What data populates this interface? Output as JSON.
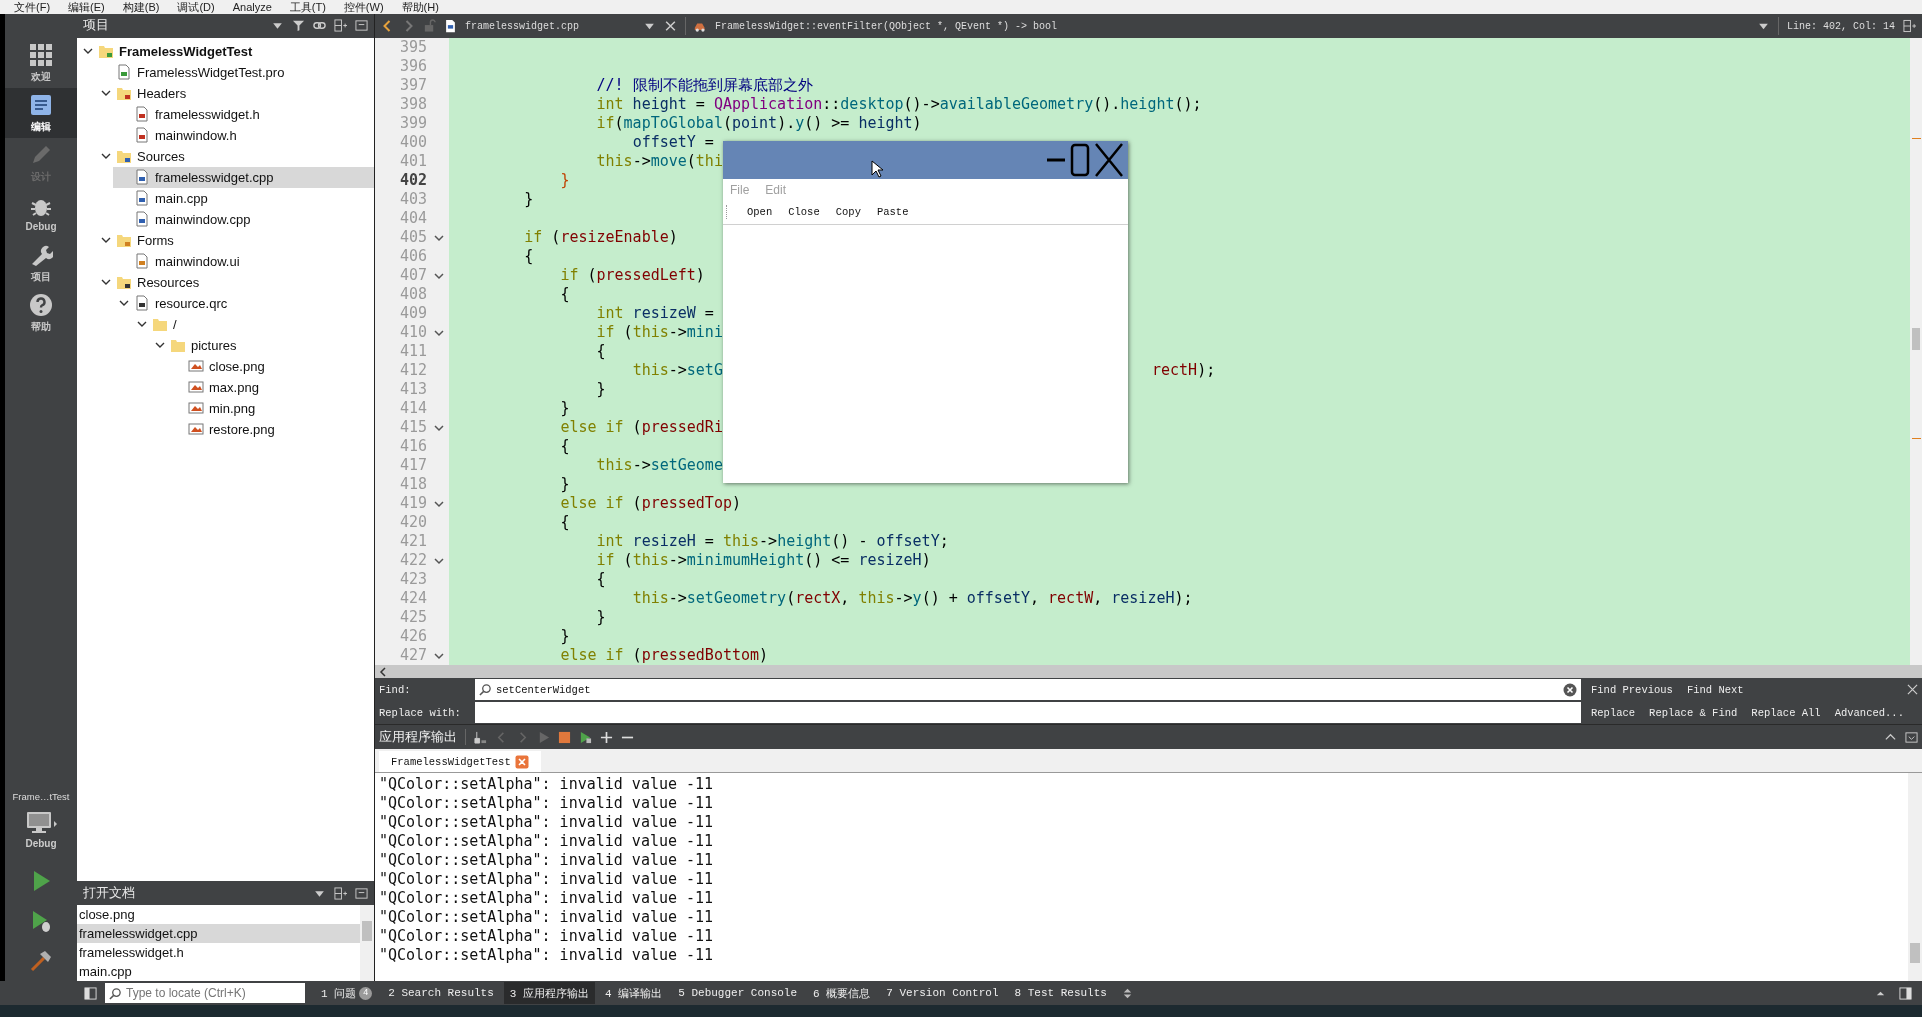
{
  "menu": [
    "文件(F)",
    "编辑(E)",
    "构建(B)",
    "调试(D)",
    "Analyze",
    "工具(T)",
    "控件(W)",
    "帮助(H)"
  ],
  "mode_bar": {
    "items": [
      {
        "label": "欢迎",
        "kind": "welcome",
        "selected": false,
        "disabled": false
      },
      {
        "label": "编辑",
        "kind": "edit",
        "selected": true,
        "disabled": false
      },
      {
        "label": "设计",
        "kind": "design",
        "selected": false,
        "disabled": true
      },
      {
        "label": "Debug",
        "kind": "debug",
        "selected": false,
        "disabled": false
      },
      {
        "label": "项目",
        "kind": "projects",
        "selected": false,
        "disabled": false
      },
      {
        "label": "帮助",
        "kind": "help",
        "selected": false,
        "disabled": false
      }
    ],
    "kit": "Frame…tTest",
    "build_config": "Debug"
  },
  "project_panel": {
    "title": "项目",
    "tree": [
      {
        "label": "FramelessWidgetTest",
        "kind": "project",
        "expanded": true,
        "selected": false,
        "children": [
          {
            "label": "FramelessWidgetTest.pro",
            "kind": "pro",
            "selected": false
          },
          {
            "label": "Headers",
            "kind": "headers",
            "expanded": true,
            "selected": false,
            "children": [
              {
                "label": "framelesswidget.h",
                "kind": "h",
                "selected": false
              },
              {
                "label": "mainwindow.h",
                "kind": "h",
                "selected": false
              }
            ]
          },
          {
            "label": "Sources",
            "kind": "sources",
            "expanded": true,
            "selected": false,
            "children": [
              {
                "label": "framelesswidget.cpp",
                "kind": "cpp",
                "selected": true
              },
              {
                "label": "main.cpp",
                "kind": "cpp",
                "selected": false
              },
              {
                "label": "mainwindow.cpp",
                "kind": "cpp",
                "selected": false
              }
            ]
          },
          {
            "label": "Forms",
            "kind": "forms",
            "expanded": true,
            "selected": false,
            "children": [
              {
                "label": "mainwindow.ui",
                "kind": "ui",
                "selected": false
              }
            ]
          },
          {
            "label": "Resources",
            "kind": "resources",
            "expanded": true,
            "selected": false,
            "children": [
              {
                "label": "resource.qrc",
                "kind": "qrc",
                "expanded": true,
                "selected": false,
                "children": [
                  {
                    "label": "/",
                    "kind": "folder",
                    "expanded": true,
                    "selected": false,
                    "children": [
                      {
                        "label": "pictures",
                        "kind": "folder",
                        "expanded": true,
                        "selected": false,
                        "children": [
                          {
                            "label": "close.png",
                            "kind": "png",
                            "selected": false
                          },
                          {
                            "label": "max.png",
                            "kind": "png",
                            "selected": false
                          },
                          {
                            "label": "min.png",
                            "kind": "png",
                            "selected": false
                          },
                          {
                            "label": "restore.png",
                            "kind": "png",
                            "selected": false
                          }
                        ]
                      }
                    ]
                  }
                ]
              }
            ]
          }
        ]
      }
    ]
  },
  "open_documents": {
    "title": "打开文档",
    "items": [
      {
        "label": "close.png",
        "selected": false
      },
      {
        "label": "framelesswidget.cpp",
        "selected": true
      },
      {
        "label": "framelesswidget.h",
        "selected": false
      },
      {
        "label": "main.cpp",
        "selected": false
      }
    ]
  },
  "editor": {
    "file": "framelesswidget.cpp",
    "symbol": "FramelessWidget::eventFilter(QObject *, QEvent *) -> bool",
    "position": "Line: 402, Col: 14",
    "lines": [
      {
        "number": "395",
        "current": false
      },
      {
        "number": "396",
        "current": false
      },
      {
        "number": "397",
        "current": false,
        "code": [
          {
            "kind": "comment",
            "text": "                //! 限制不能拖到屏幕底部之外"
          }
        ]
      },
      {
        "number": "398",
        "current": false,
        "code": [
          {
            "kind": "keyword",
            "text": "                int"
          },
          {
            "kind": "local",
            "text": " height"
          },
          {
            "kind": "plain",
            "text": " = "
          },
          {
            "kind": "class",
            "text": "QApplication"
          },
          {
            "kind": "plain",
            "text": "::"
          },
          {
            "kind": "function",
            "text": "desktop"
          },
          {
            "kind": "plain",
            "text": "()->"
          },
          {
            "kind": "function",
            "text": "availableGeometry"
          },
          {
            "kind": "plain",
            "text": "()."
          },
          {
            "kind": "function",
            "text": "height"
          },
          {
            "kind": "plain",
            "text": "();"
          }
        ]
      },
      {
        "number": "399",
        "current": false,
        "code": [
          {
            "kind": "keyword",
            "text": "                if"
          },
          {
            "kind": "plain",
            "text": "("
          },
          {
            "kind": "function",
            "text": "mapToGlobal"
          },
          {
            "kind": "plain",
            "text": "("
          },
          {
            "kind": "local",
            "text": "point"
          },
          {
            "kind": "plain",
            "text": ")."
          },
          {
            "kind": "function",
            "text": "y"
          },
          {
            "kind": "plain",
            "text": "() >= "
          },
          {
            "kind": "local",
            "text": "height"
          },
          {
            "kind": "plain",
            "text": ")"
          }
        ]
      },
      {
        "number": "400",
        "current": false,
        "code": [
          {
            "kind": "local",
            "text": "                    offsetY"
          },
          {
            "kind": "plain",
            "text": " ="
          }
        ]
      },
      {
        "number": "401",
        "current": false,
        "code": [
          {
            "kind": "keyword",
            "text": "                this"
          },
          {
            "kind": "plain",
            "text": "->"
          },
          {
            "kind": "function",
            "text": "move"
          },
          {
            "kind": "plain",
            "text": "("
          },
          {
            "kind": "keyword",
            "text": "thi"
          }
        ]
      },
      {
        "number": "402",
        "current": true,
        "code": [
          {
            "kind": "brace",
            "text": "            }"
          }
        ]
      },
      {
        "number": "403",
        "current": false,
        "code": [
          {
            "kind": "plain",
            "text": "        }"
          }
        ]
      },
      {
        "number": "404",
        "current": false
      },
      {
        "number": "405",
        "current": false,
        "fold": true,
        "code": [
          {
            "kind": "keyword",
            "text": "        if"
          },
          {
            "kind": "plain",
            "text": " ("
          },
          {
            "kind": "member",
            "text": "resizeEnable"
          },
          {
            "kind": "plain",
            "text": ")"
          }
        ]
      },
      {
        "number": "406",
        "current": false,
        "code": [
          {
            "kind": "plain",
            "text": "        {"
          }
        ]
      },
      {
        "number": "407",
        "current": false,
        "fold": true,
        "code": [
          {
            "kind": "keyword",
            "text": "            if"
          },
          {
            "kind": "plain",
            "text": " ("
          },
          {
            "kind": "member",
            "text": "pressedLeft"
          },
          {
            "kind": "plain",
            "text": ")"
          }
        ]
      },
      {
        "number": "408",
        "current": false,
        "code": [
          {
            "kind": "plain",
            "text": "            {"
          }
        ]
      },
      {
        "number": "409",
        "current": false,
        "code": [
          {
            "kind": "keyword",
            "text": "                int"
          },
          {
            "kind": "local",
            "text": " resizeW"
          },
          {
            "kind": "plain",
            "text": " ="
          }
        ]
      },
      {
        "number": "410",
        "current": false,
        "fold": true,
        "code": [
          {
            "kind": "keyword",
            "text": "                if"
          },
          {
            "kind": "plain",
            "text": " ("
          },
          {
            "kind": "keyword",
            "text": "this"
          },
          {
            "kind": "plain",
            "text": "->"
          },
          {
            "kind": "function",
            "text": "mini"
          }
        ]
      },
      {
        "number": "411",
        "current": false,
        "code": [
          {
            "kind": "plain",
            "text": "                {"
          }
        ]
      },
      {
        "number": "412",
        "current": false,
        "code": [
          {
            "kind": "keyword",
            "text": "                    this"
          },
          {
            "kind": "plain",
            "text": "->"
          },
          {
            "kind": "function",
            "text": "setG"
          }
        ],
        "tail": [
          {
            "kind": "member",
            "text": "rectH"
          },
          {
            "kind": "plain",
            "text": ");"
          }
        ]
      },
      {
        "number": "413",
        "current": false,
        "code": [
          {
            "kind": "plain",
            "text": "                }"
          }
        ]
      },
      {
        "number": "414",
        "current": false,
        "code": [
          {
            "kind": "plain",
            "text": "            }"
          }
        ]
      },
      {
        "number": "415",
        "current": false,
        "fold": true,
        "code": [
          {
            "kind": "keyword",
            "text": "            else if"
          },
          {
            "kind": "plain",
            "text": " ("
          },
          {
            "kind": "member",
            "text": "pressedRi"
          }
        ]
      },
      {
        "number": "416",
        "current": false,
        "code": [
          {
            "kind": "plain",
            "text": "            {"
          }
        ]
      },
      {
        "number": "417",
        "current": false,
        "code": [
          {
            "kind": "keyword",
            "text": "                this"
          },
          {
            "kind": "plain",
            "text": "->"
          },
          {
            "kind": "function",
            "text": "setGeome"
          }
        ]
      },
      {
        "number": "418",
        "current": false,
        "code": [
          {
            "kind": "plain",
            "text": "            }"
          }
        ]
      },
      {
        "number": "419",
        "current": false,
        "fold": true,
        "code": [
          {
            "kind": "keyword",
            "text": "            else if"
          },
          {
            "kind": "plain",
            "text": " ("
          },
          {
            "kind": "member",
            "text": "pressedTop"
          },
          {
            "kind": "plain",
            "text": ")"
          }
        ]
      },
      {
        "number": "420",
        "current": false,
        "code": [
          {
            "kind": "plain",
            "text": "            {"
          }
        ]
      },
      {
        "number": "421",
        "current": false,
        "code": [
          {
            "kind": "keyword",
            "text": "                int"
          },
          {
            "kind": "local",
            "text": " resizeH"
          },
          {
            "kind": "plain",
            "text": " = "
          },
          {
            "kind": "keyword",
            "text": "this"
          },
          {
            "kind": "plain",
            "text": "->"
          },
          {
            "kind": "function",
            "text": "height"
          },
          {
            "kind": "plain",
            "text": "() - "
          },
          {
            "kind": "local",
            "text": "offsetY"
          },
          {
            "kind": "plain",
            "text": ";"
          }
        ]
      },
      {
        "number": "422",
        "current": false,
        "fold": true,
        "code": [
          {
            "kind": "keyword",
            "text": "                if"
          },
          {
            "kind": "plain",
            "text": " ("
          },
          {
            "kind": "keyword",
            "text": "this"
          },
          {
            "kind": "plain",
            "text": "->"
          },
          {
            "kind": "function",
            "text": "minimumHeight"
          },
          {
            "kind": "plain",
            "text": "() <= "
          },
          {
            "kind": "local",
            "text": "resizeH"
          },
          {
            "kind": "plain",
            "text": ")"
          }
        ]
      },
      {
        "number": "423",
        "current": false,
        "code": [
          {
            "kind": "plain",
            "text": "                {"
          }
        ]
      },
      {
        "number": "424",
        "current": false,
        "code": [
          {
            "kind": "keyword",
            "text": "                    this"
          },
          {
            "kind": "plain",
            "text": "->"
          },
          {
            "kind": "function",
            "text": "setGeometry"
          },
          {
            "kind": "plain",
            "text": "("
          },
          {
            "kind": "member",
            "text": "rectX"
          },
          {
            "kind": "plain",
            "text": ", "
          },
          {
            "kind": "keyword",
            "text": "this"
          },
          {
            "kind": "plain",
            "text": "->"
          },
          {
            "kind": "function",
            "text": "y"
          },
          {
            "kind": "plain",
            "text": "() + "
          },
          {
            "kind": "local",
            "text": "offsetY"
          },
          {
            "kind": "plain",
            "text": ", "
          },
          {
            "kind": "member",
            "text": "rectW"
          },
          {
            "kind": "plain",
            "text": ", "
          },
          {
            "kind": "local",
            "text": "resizeH"
          },
          {
            "kind": "plain",
            "text": ");"
          }
        ]
      },
      {
        "number": "425",
        "current": false,
        "code": [
          {
            "kind": "plain",
            "text": "                }"
          }
        ]
      },
      {
        "number": "426",
        "current": false,
        "code": [
          {
            "kind": "plain",
            "text": "            }"
          }
        ]
      },
      {
        "number": "427",
        "current": false,
        "fold": true,
        "code": [
          {
            "kind": "keyword",
            "text": "            else if"
          },
          {
            "kind": "plain",
            "text": " ("
          },
          {
            "kind": "member",
            "text": "pressedBottom"
          },
          {
            "kind": "plain",
            "text": ")"
          }
        ]
      }
    ]
  },
  "floating_window": {
    "menu": [
      {
        "label": "File",
        "disabled": true
      },
      {
        "label": "Edit",
        "disabled": true
      }
    ],
    "toolbar": [
      "Open",
      "Close",
      "Copy",
      "Paste"
    ]
  },
  "find_bar": {
    "find_label": "Find:",
    "find_value": "setCenterWidget",
    "replace_label": "Replace with:",
    "find_buttons": [
      "Find Previous",
      "Find Next"
    ],
    "replace_buttons": [
      "Replace",
      "Replace & Find",
      "Replace All",
      "Advanced..."
    ]
  },
  "output_pane": {
    "title": "应用程序输出",
    "tab": "FramelessWidgetTest",
    "lines": [
      "\"QColor::setAlpha\": invalid value -11",
      "\"QColor::setAlpha\": invalid value -11",
      "\"QColor::setAlpha\": invalid value -11",
      "\"QColor::setAlpha\": invalid value -11",
      "\"QColor::setAlpha\": invalid value -11",
      "\"QColor::setAlpha\": invalid value -11",
      "\"QColor::setAlpha\": invalid value -11",
      "\"QColor::setAlpha\": invalid value -11",
      "\"QColor::setAlpha\": invalid value -11",
      "\"QColor::setAlpha\": invalid value -11"
    ]
  },
  "status_bar": {
    "locate_placeholder": "Type to locate (Ctrl+K)",
    "tabs": [
      {
        "label": "1 问题",
        "badge": "4",
        "selected": false
      },
      {
        "label": "2 Search Results",
        "selected": false
      },
      {
        "label": "3 应用程序输出",
        "selected": true
      },
      {
        "label": "4 编译输出",
        "selected": false
      },
      {
        "label": "5 Debugger Console",
        "selected": false
      },
      {
        "label": "6 概要信息",
        "selected": false
      },
      {
        "label": "7 Version Control",
        "selected": false
      },
      {
        "label": "8 Test Results",
        "selected": false
      }
    ]
  }
}
